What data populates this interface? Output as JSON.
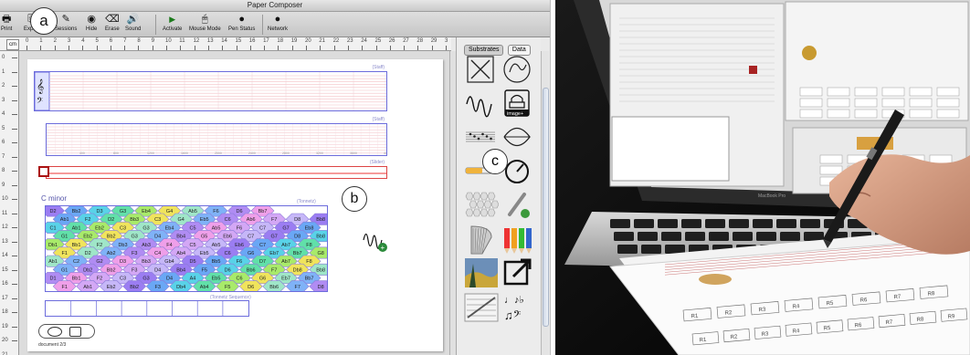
{
  "window": {
    "title": "Paper Composer"
  },
  "toolbar": {
    "items": [
      {
        "label": "Print",
        "icon": "printer-icon"
      },
      {
        "label": "Export",
        "icon": "export-icon"
      },
      {
        "label": "Sessions",
        "icon": "sessions-icon"
      },
      {
        "label": "Hide",
        "icon": "eye-icon"
      },
      {
        "label": "Erase",
        "icon": "eraser-icon"
      },
      {
        "label": "Sound",
        "icon": "speaker-icon"
      },
      {
        "label": "Activate",
        "icon": "play-icon"
      },
      {
        "label": "Mouse Mode",
        "icon": "mouse-icon"
      },
      {
        "label": "Pen Status",
        "icon": "pen-icon"
      },
      {
        "label": "Network",
        "icon": "network-icon"
      }
    ]
  },
  "annotations": {
    "a": "a",
    "b": "b",
    "c": "c"
  },
  "ruler": {
    "unit": "cm",
    "top_ticks": [
      "0",
      "1",
      "2",
      "3",
      "4",
      "5",
      "6",
      "7",
      "8",
      "9",
      "10",
      "11",
      "12",
      "13",
      "14",
      "15",
      "16",
      "17",
      "18",
      "19",
      "20",
      "21",
      "22",
      "23",
      "24",
      "25",
      "26",
      "27",
      "28",
      "29",
      "3"
    ],
    "left_ticks": [
      "0",
      "1",
      "2",
      "3",
      "4",
      "5",
      "6",
      "7",
      "8",
      "9",
      "10",
      "11",
      "12",
      "13",
      "14",
      "15",
      "16",
      "17",
      "18",
      "19",
      "20",
      "21"
    ]
  },
  "paper": {
    "staff1_label": "(Staff)",
    "staff2_label": "(Staff)",
    "slider_label": "(Slider)",
    "grid_title": "C minor",
    "grid_label": "(Tonnetz)",
    "sequence_label": "(Tonnetz Sequence)",
    "axis_numbers": [
      "400",
      "800",
      "1200",
      "1600",
      "2000",
      "2400",
      "2800",
      "3200",
      "3600",
      "4000"
    ],
    "document_label": "document 2/3",
    "tonnetz_rows": [
      [
        "D2",
        "Bb2",
        "D3",
        "G3",
        "Eb4",
        "G4",
        "Ab5",
        "F6",
        "D6",
        "Bb7"
      ],
      [
        "Ab1",
        "F2",
        "D2",
        "Bb3",
        "C3",
        "G4",
        "Eb5",
        "C6",
        "Ab6",
        "F7",
        "D8",
        "Bb8"
      ],
      [
        "C1",
        "Ab1",
        "Eb2",
        "C3",
        "G3",
        "Eb4",
        "C5",
        "Ab5",
        "F6",
        "C7",
        "G7",
        "Eb8"
      ],
      [
        "G1",
        "Eb2",
        "Bb2",
        "G3",
        "D4",
        "Bb4",
        "G5",
        "Eb6",
        "C7",
        "G7",
        "D8",
        "Bb8"
      ],
      [
        "Db1",
        "Bb1",
        "F2",
        "Db3",
        "Ab3",
        "F4",
        "C5",
        "Ab5",
        "Eb6",
        "C7",
        "Ab7",
        "F8"
      ],
      [
        "F1",
        "D2",
        "Ab2",
        "F3",
        "C4",
        "Ab4",
        "Eb5",
        "C6",
        "G6",
        "Eb7",
        "Bb7",
        "G8"
      ],
      [
        "Ab1",
        "C2",
        "G2",
        "D3",
        "Bb3",
        "Gb4",
        "D5",
        "Bb5",
        "F6",
        "D7",
        "Ab7",
        "F8"
      ],
      [
        "G1",
        "Db2",
        "Bb2",
        "F3",
        "D4",
        "Bb4",
        "F5",
        "D6",
        "Bb6",
        "F7",
        "Db8",
        "Bb8"
      ],
      [
        "D1",
        "Bb1",
        "F2",
        "C3",
        "G3",
        "D4",
        "A4",
        "Eb5",
        "C6",
        "G6",
        "Eb7",
        "Bb7"
      ],
      [
        "F1",
        "Ab1",
        "Eb2",
        "Bb2",
        "F3",
        "Db4",
        "Ab4",
        "F5",
        "D6",
        "Bb6",
        "F7",
        "D8"
      ]
    ]
  },
  "palette": {
    "tabs": [
      "Substrates",
      "Data"
    ],
    "items": [
      {
        "name": "cross-substrate-icon"
      },
      {
        "name": "spiral-substrate-icon"
      },
      {
        "name": "waveform-substrate-icon"
      },
      {
        "name": "image-add-substrate-icon",
        "label": "image+"
      },
      {
        "name": "staff-substrate-icon"
      },
      {
        "name": "loop-substrate-icon"
      },
      {
        "name": "slider-substrate-icon"
      },
      {
        "name": "dial-substrate-icon"
      },
      {
        "name": "tonnetz-substrate-icon"
      },
      {
        "name": "link-add-substrate-icon"
      },
      {
        "name": "harp-substrate-icon"
      },
      {
        "name": "colored-pencils-icon"
      },
      {
        "name": "painting-substrate-icon"
      },
      {
        "name": "export-arrow-icon"
      },
      {
        "name": "score-substrate-icon"
      },
      {
        "name": "notation-substrate-icon"
      }
    ]
  },
  "photo": {
    "laptop_brand": "MacBook Pro",
    "paper_cells_row1": [
      "R1",
      "R2",
      "R3",
      "R4",
      "R5",
      "R6",
      "R7",
      "R8"
    ],
    "paper_cells_row2": [
      "R1",
      "R2",
      "R3",
      "R4",
      "R5",
      "R6",
      "R7",
      "R8",
      "R9"
    ]
  }
}
